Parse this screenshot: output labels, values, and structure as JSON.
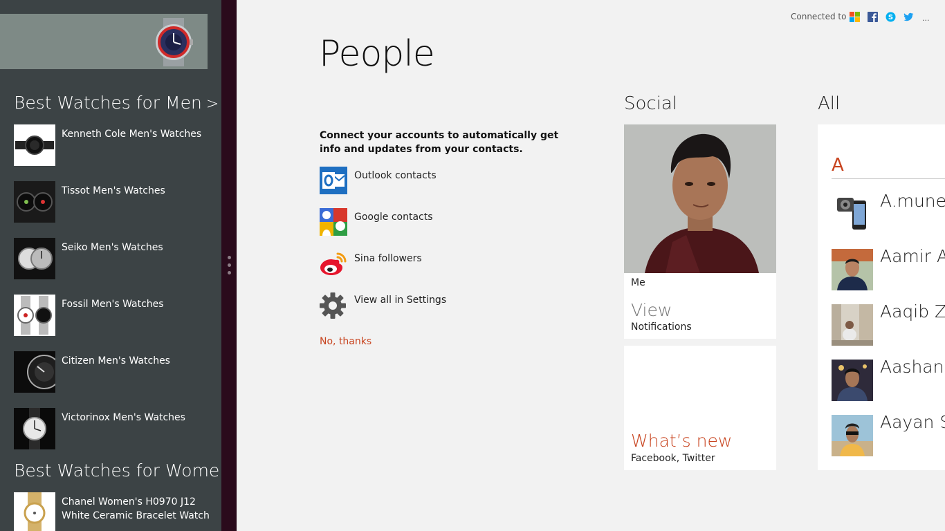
{
  "snap_app": {
    "sections": [
      {
        "title": "Best Watches for Men",
        "chevron": ">",
        "items": [
          {
            "label": "Kenneth Cole Men's Watches"
          },
          {
            "label": "Tissot Men's Watches"
          },
          {
            "label": "Seiko Men's Watches"
          },
          {
            "label": "Fossil Men's Watches"
          },
          {
            "label": "Citizen Men's Watches"
          },
          {
            "label": "Victorinox Men's Watches"
          }
        ]
      },
      {
        "title": "Best Watches for Women",
        "chevron": ">",
        "items": [
          {
            "label": "Chanel Women's H0970 J12 White Ceramic Bracelet Watch"
          }
        ]
      }
    ]
  },
  "header": {
    "connected_label": "Connected to",
    "networks": [
      "microsoft-icon",
      "facebook-icon",
      "skype-icon",
      "twitter-icon"
    ],
    "more": "..."
  },
  "page": {
    "title": "People",
    "connect_text": "Connect your accounts to automatically get info and updates from your contacts.",
    "accounts": [
      {
        "label": "Outlook contacts",
        "icon": "outlook-icon"
      },
      {
        "label": "Google contacts",
        "icon": "google-icon"
      },
      {
        "label": "Sina followers",
        "icon": "sina-weibo-icon"
      },
      {
        "label": "View all in Settings",
        "icon": "gear-icon"
      }
    ],
    "no_thanks": "No, thanks"
  },
  "social": {
    "heading": "Social",
    "me_tile": {
      "name": "Me",
      "view": "View",
      "notifications": "Notifications"
    },
    "whats_new": {
      "title": "What’s new",
      "subtitle": "Facebook, Twitter"
    }
  },
  "all": {
    "heading": "All",
    "letter": "A",
    "contacts": [
      {
        "name": "A.munee"
      },
      {
        "name": "Aamir As"
      },
      {
        "name": "Aaqib Za"
      },
      {
        "name": "Aashan I"
      },
      {
        "name": "Aayan Sa"
      }
    ]
  },
  "colors": {
    "accent": "#c8441f",
    "snap_bg": "#3c4345",
    "splitter": "#2a0b1c",
    "outlook_blue": "#1e6fc1",
    "bg": "#f2f2f2"
  }
}
